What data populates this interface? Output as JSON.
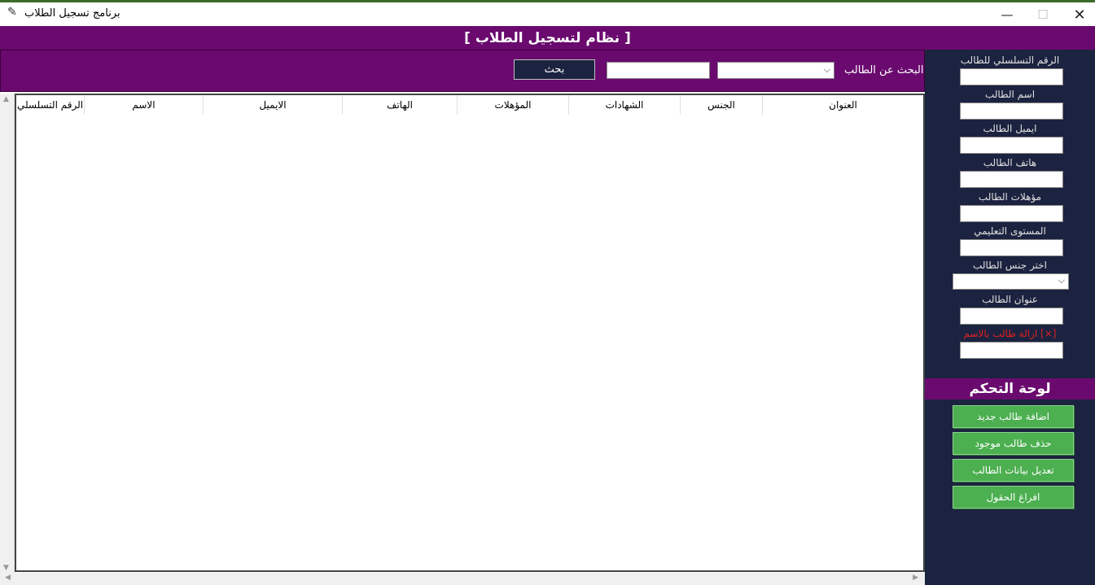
{
  "window": {
    "title": "برنامج تسجيل الطلاب",
    "app_icon": "feather-icon",
    "min_glyph": "—",
    "max_glyph": "☐",
    "close_glyph": "✕"
  },
  "header": {
    "title": "[ نظام لتسجيل الطلاب ]"
  },
  "search": {
    "label": "البحث عن الطالب",
    "select_value": "",
    "input_value": "",
    "button_label": "بحث"
  },
  "table": {
    "columns": [
      "الرقم التسلسلي",
      "الاسم",
      "الايميل",
      "الهاتف",
      "المؤهلات",
      "الشهادات",
      "الجنس",
      "العنوان"
    ],
    "rows": []
  },
  "sidebar": {
    "fields": [
      {
        "label": "الرقم التسلسلي للطالب",
        "value": ""
      },
      {
        "label": "اسم الطالب",
        "value": ""
      },
      {
        "label": "ايميل الطالب",
        "value": ""
      },
      {
        "label": "هاتف الطالب",
        "value": ""
      },
      {
        "label": "مؤهلات الطالب",
        "value": ""
      },
      {
        "label": "المستوى التعليمي",
        "value": ""
      }
    ],
    "gender_label": "اختر جنس الطالب",
    "gender_value": "",
    "address_label": "عنوان الطالب",
    "address_value": "",
    "remove_label": "[×] ازالة طالب بالاسم",
    "remove_value": "",
    "control_title": "لوحة التحكم",
    "buttons": [
      "اضافة طالب جديد",
      "حذف طالب موجود",
      "تعديل بيانات الطالب",
      "افراغ الحقول"
    ]
  },
  "colors": {
    "purple": "#6a0a6e",
    "navy": "#1c2340",
    "green": "#4caf50",
    "red_label": "#e02020"
  }
}
